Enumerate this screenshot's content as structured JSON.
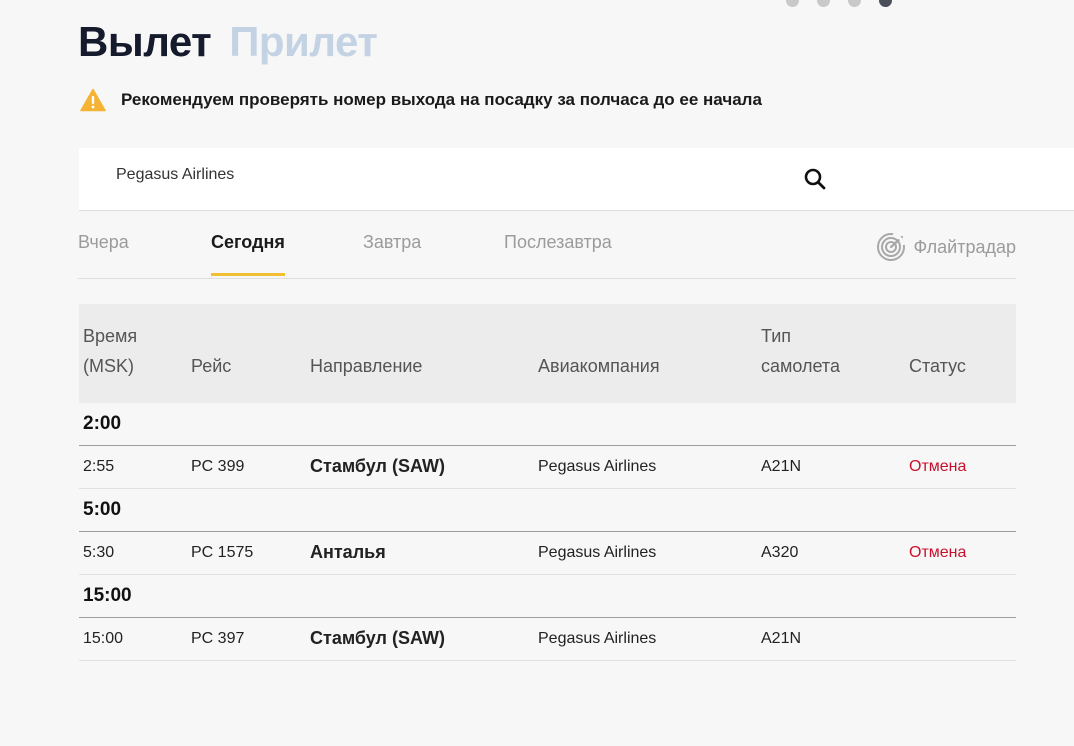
{
  "carousel": {
    "dots": [
      {
        "state": "inactive"
      },
      {
        "state": "inactive"
      },
      {
        "state": "inactive"
      },
      {
        "state": "active"
      }
    ]
  },
  "header": {
    "departures_label": "Вылет",
    "arrivals_label": "Прилет"
  },
  "notice": {
    "icon": "warning-icon",
    "text": "Рекомендуем проверять номер выхода на посадку за полчаса до ее начала"
  },
  "search": {
    "value": "Pegasus Airlines",
    "icon": "search-icon"
  },
  "days": {
    "tabs": [
      {
        "label": "Вчера",
        "active": false
      },
      {
        "label": "Сегодня",
        "active": true
      },
      {
        "label": "Завтра",
        "active": false
      },
      {
        "label": "Послезавтра",
        "active": false
      }
    ],
    "flightradar_label": "Флайтрадар"
  },
  "table": {
    "columns": {
      "time_line1": "Время",
      "time_line2": "(MSK)",
      "flight": "Рейс",
      "destination": "Направление",
      "airline": "Авиакомпания",
      "aircraft_line1": "Тип",
      "aircraft_line2": "самолета",
      "status": "Статус"
    },
    "groups": [
      {
        "label": "2:00",
        "rows": [
          {
            "time": "2:55",
            "flight": "PC 399",
            "destination": "Стамбул (SAW)",
            "airline": "Pegasus Airlines",
            "aircraft": "A21N",
            "status": "Отмена"
          }
        ]
      },
      {
        "label": "5:00",
        "rows": [
          {
            "time": "5:30",
            "flight": "PC 1575",
            "destination": "Анталья",
            "airline": "Pegasus Airlines",
            "aircraft": "A320",
            "status": "Отмена"
          }
        ]
      },
      {
        "label": "15:00",
        "rows": [
          {
            "time": "15:00",
            "flight": "PC 397",
            "destination": "Стамбул (SAW)",
            "airline": "Pegasus Airlines",
            "aircraft": "A21N",
            "status": ""
          }
        ]
      }
    ]
  },
  "colors": {
    "accent_underline": "#f0c032",
    "status_cancelled": "#c8102e",
    "heading_active": "#151a2c",
    "heading_inactive": "#c4d3e3",
    "warning": "#f5b335"
  }
}
